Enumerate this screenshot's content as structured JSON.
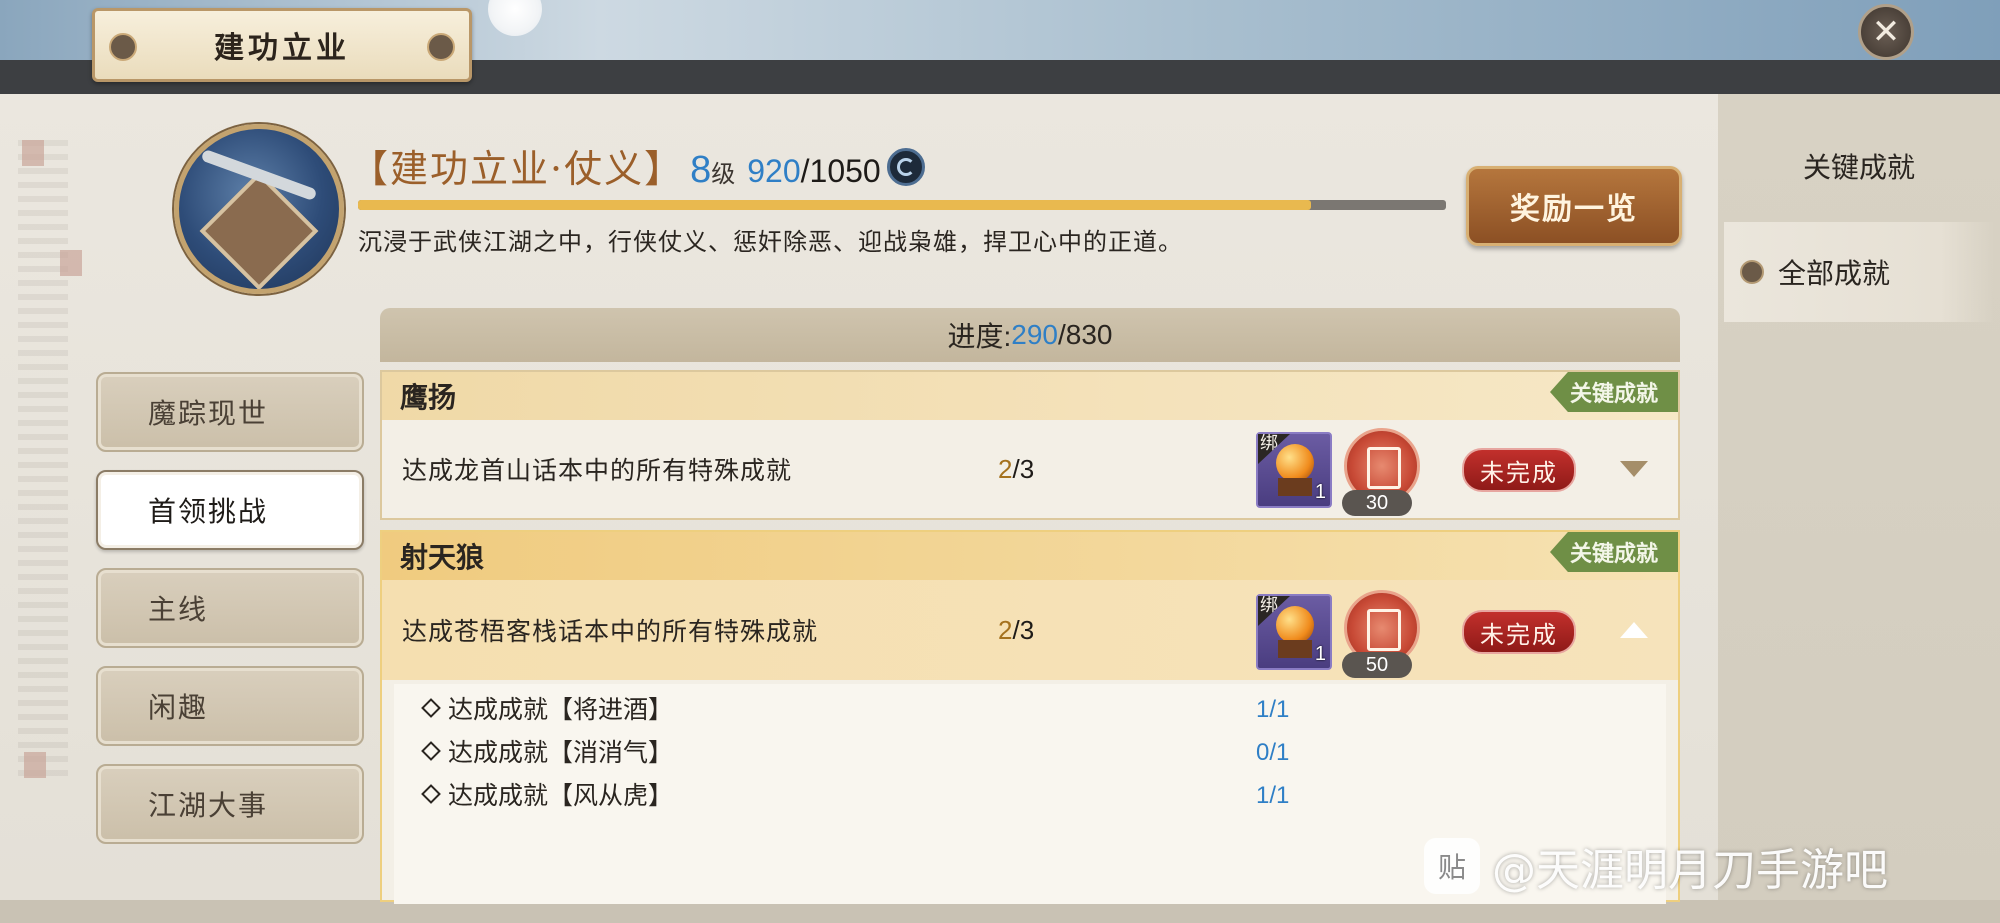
{
  "window": {
    "title": "建功立业",
    "close_symbol": "✕"
  },
  "achievement": {
    "name": "【建功立业·仗义】",
    "level": "8",
    "level_unit": "级",
    "exp_current": "920",
    "exp_sep": "/",
    "exp_max": "1050",
    "exp_fraction": 0.876,
    "description": "沉浸于武侠江湖之中，行侠仗义、惩奸除恶、迎战枭雄，捍卫心中的正道。"
  },
  "reward_button": "奖励一览",
  "right_tabs": [
    {
      "label": "关键成就"
    },
    {
      "label": "全部成就",
      "selected": true
    }
  ],
  "categories": [
    {
      "label": "魔踪现世"
    },
    {
      "label": "首领挑战",
      "selected": true
    },
    {
      "label": "主线"
    },
    {
      "label": "闲趣"
    },
    {
      "label": "江湖大事"
    }
  ],
  "progress": {
    "label": "进度:",
    "current": "290",
    "sep": "/",
    "total": "830"
  },
  "groups": [
    {
      "title": "鹰扬",
      "tag": "关键成就",
      "desc": "达成龙首山话本中的所有特殊成就",
      "prog_current": "2",
      "prog_rest": "/3",
      "item_bind": "绑",
      "item_count": "1",
      "token_count": "30",
      "status": "未完成",
      "expanded": false
    },
    {
      "title": "射天狼",
      "tag": "关键成就",
      "desc": "达成苍梧客栈话本中的所有特殊成就",
      "prog_current": "2",
      "prog_rest": "/3",
      "item_bind": "绑",
      "item_count": "1",
      "token_count": "50",
      "status": "未完成",
      "expanded": true,
      "sub_items": [
        {
          "label": "达成成就【将进酒】",
          "progress": "1/1"
        },
        {
          "label": "达成成就【消消气】",
          "progress": "0/1"
        },
        {
          "label": "达成成就【风从虎】",
          "progress": "1/1"
        }
      ]
    }
  ],
  "watermark": {
    "badge": "贴",
    "text": "@天涯明月刀手游吧"
  },
  "colors": {
    "accent_blue": "#2f7fc6",
    "key_tag_green": "#6f8f46",
    "status_red": "#c2302c",
    "exp_bar": "#e9b94f"
  }
}
